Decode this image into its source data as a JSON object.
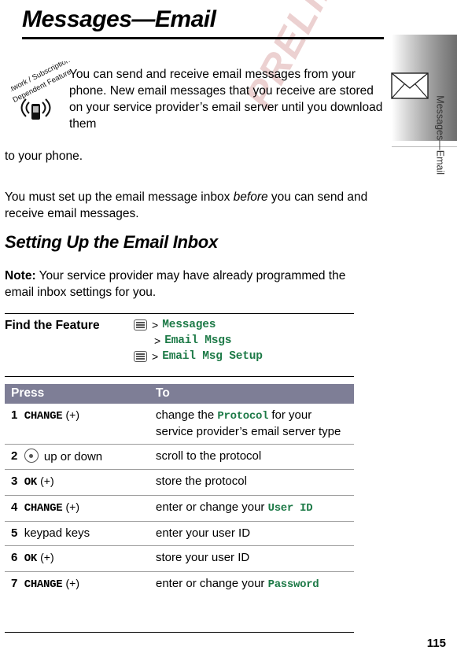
{
  "page": {
    "title": "Messages—Email",
    "number": "115",
    "watermark": "PRELIMINARY",
    "side_tab_label": "Messages—Email"
  },
  "badge": {
    "line1": "Network / Subscription",
    "line2": "Dependent Feature",
    "icon": "phone-tower-icon"
  },
  "icons": {
    "envelope": "envelope-icon"
  },
  "body": {
    "para1": "You can send and receive email messages from your phone. New email messages that you receive are stored on your service provider’s email server until you download them",
    "para1_cont": "to your phone.",
    "para2_before": "You must set up the email message inbox ",
    "para2_italic": "before",
    "para2_after": " you can send and receive email messages."
  },
  "section": {
    "heading": "Setting Up the Email Inbox",
    "note_label": "Note:",
    "note_text": " Your service provider may have already programmed the email inbox settings for you."
  },
  "find_feature": {
    "label": "Find the Feature",
    "lines": [
      {
        "key": "menu-key-icon",
        "sep": ">",
        "text": "Messages",
        "indent": false
      },
      {
        "key": "",
        "sep": ">",
        "text": "Email Msgs",
        "indent": true
      },
      {
        "key": "menu-key-icon",
        "sep": ">",
        "text": "Email Msg Setup",
        "indent": false
      }
    ]
  },
  "table": {
    "headers": [
      "Press",
      "To"
    ],
    "rows": [
      {
        "num": "1",
        "action_cmd": "CHANGE",
        "action_paren": "(+)",
        "action_key": "softkey-plus-icon",
        "to_parts": [
          {
            "t": "change the ",
            "style": "plain"
          },
          {
            "t": "Protocol",
            "style": "mono"
          },
          {
            "t": " for your service provider’s email server type",
            "style": "plain"
          }
        ]
      },
      {
        "num": "2",
        "action_cmd": "",
        "action_paren": "",
        "action_key": "nav-key-icon",
        "action_plain": " up or down",
        "to_parts": [
          {
            "t": "scroll to the protocol",
            "style": "plain"
          }
        ]
      },
      {
        "num": "3",
        "action_cmd": "OK",
        "action_paren": "(+)",
        "action_key": "softkey-plus-icon",
        "to_parts": [
          {
            "t": "store the protocol",
            "style": "plain"
          }
        ]
      },
      {
        "num": "4",
        "action_cmd": "CHANGE",
        "action_paren": "(+)",
        "action_key": "softkey-plus-icon",
        "to_parts": [
          {
            "t": "enter or change your ",
            "style": "plain"
          },
          {
            "t": "User ID",
            "style": "mono"
          }
        ]
      },
      {
        "num": "5",
        "action_cmd": "",
        "action_paren": "",
        "action_key": "",
        "action_plain": "keypad keys",
        "to_parts": [
          {
            "t": "enter your user ID",
            "style": "plain"
          }
        ]
      },
      {
        "num": "6",
        "action_cmd": "OK",
        "action_paren": "(+)",
        "action_key": "softkey-plus-icon",
        "to_parts": [
          {
            "t": "store your user ID",
            "style": "plain"
          }
        ]
      },
      {
        "num": "7",
        "action_cmd": "CHANGE",
        "action_paren": "(+)",
        "action_key": "softkey-plus-icon",
        "to_parts": [
          {
            "t": "enter or change your ",
            "style": "plain"
          },
          {
            "t": "Password",
            "style": "mono"
          }
        ]
      }
    ]
  },
  "colors": {
    "accent_green": "#1d7a47",
    "table_header_bg": "#7e7e96",
    "watermark": "#e9c9c9"
  }
}
